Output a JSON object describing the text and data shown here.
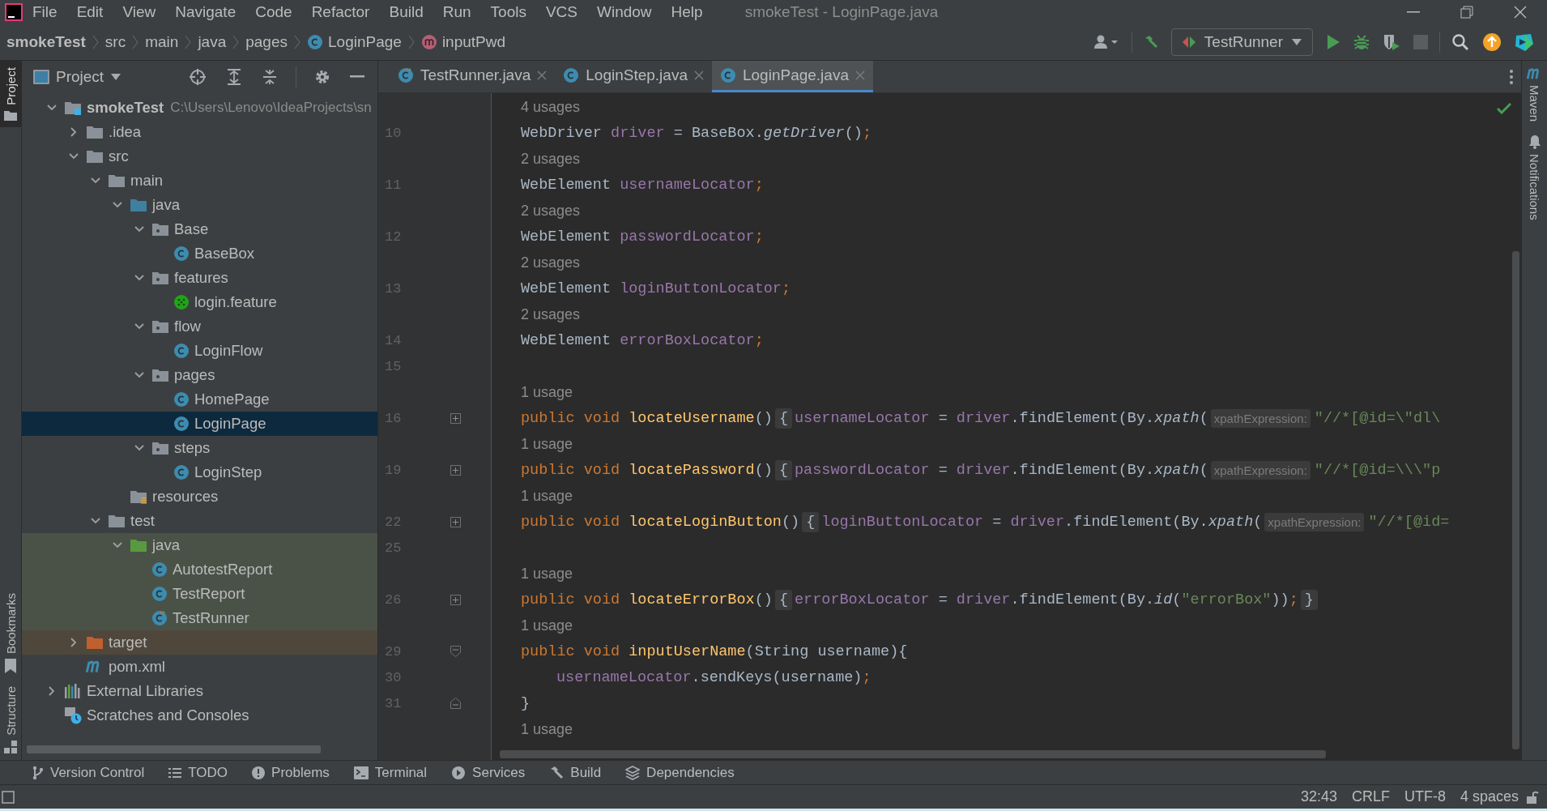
{
  "menu": [
    "File",
    "Edit",
    "View",
    "Navigate",
    "Code",
    "Refactor",
    "Build",
    "Run",
    "Tools",
    "VCS",
    "Window",
    "Help"
  ],
  "window": {
    "title": "smokeTest - LoginPage.java"
  },
  "breadcrumbs": [
    {
      "label": "smokeTest",
      "kind": "project"
    },
    {
      "label": "src",
      "kind": "folder"
    },
    {
      "label": "main",
      "kind": "folder"
    },
    {
      "label": "java",
      "kind": "folder"
    },
    {
      "label": "pages",
      "kind": "folder"
    },
    {
      "label": "LoginPage",
      "kind": "class"
    },
    {
      "label": "inputPwd",
      "kind": "method"
    }
  ],
  "run_config": {
    "label": "TestRunner"
  },
  "left_strip": {
    "top": [
      {
        "label": "Project",
        "kind": "folder",
        "selected": true
      }
    ],
    "bottom": [
      {
        "label": "Bookmarks",
        "kind": "bookmark",
        "selected": false
      },
      {
        "label": "Structure",
        "kind": "structure",
        "selected": false
      }
    ]
  },
  "project": {
    "title": "Project",
    "tree": [
      {
        "label": "smokeTest",
        "path": "C:\\Users\\Lenovo\\IdeaProjects\\sn",
        "kind": "module",
        "expanded": true,
        "selected": false,
        "children": [
          {
            "label": ".idea",
            "kind": "folder",
            "expanded": false,
            "selected": false
          },
          {
            "label": "src",
            "kind": "folder",
            "expanded": true,
            "selected": false,
            "children": [
              {
                "label": "main",
                "kind": "folder",
                "expanded": true,
                "selected": false,
                "children": [
                  {
                    "label": "java",
                    "kind": "source-root",
                    "expanded": true,
                    "selected": false,
                    "children": [
                      {
                        "label": "Base",
                        "kind": "package",
                        "expanded": true,
                        "selected": false,
                        "children": [
                          {
                            "label": "BaseBox",
                            "kind": "class",
                            "selected": false
                          }
                        ]
                      },
                      {
                        "label": "features",
                        "kind": "package",
                        "expanded": true,
                        "selected": false,
                        "children": [
                          {
                            "label": "login.feature",
                            "kind": "cucumber",
                            "selected": false
                          }
                        ]
                      },
                      {
                        "label": "flow",
                        "kind": "package",
                        "expanded": true,
                        "selected": false,
                        "children": [
                          {
                            "label": "LoginFlow",
                            "kind": "class",
                            "selected": false
                          }
                        ]
                      },
                      {
                        "label": "pages",
                        "kind": "package",
                        "expanded": true,
                        "selected": false,
                        "children": [
                          {
                            "label": "HomePage",
                            "kind": "class",
                            "selected": false
                          },
                          {
                            "label": "LoginPage",
                            "kind": "class",
                            "selected": true
                          }
                        ]
                      },
                      {
                        "label": "steps",
                        "kind": "package",
                        "expanded": true,
                        "selected": false,
                        "children": [
                          {
                            "label": "LoginStep",
                            "kind": "class",
                            "selected": false
                          }
                        ]
                      }
                    ]
                  },
                  {
                    "label": "resources",
                    "kind": "resources",
                    "selected": false
                  }
                ]
              },
              {
                "label": "test",
                "kind": "folder",
                "expanded": true,
                "selected": false,
                "children": [
                  {
                    "label": "java",
                    "kind": "test-root",
                    "expanded": true,
                    "selected": false,
                    "children": [
                      {
                        "label": "AutotestReport",
                        "kind": "class",
                        "selected": false
                      },
                      {
                        "label": "TestReport",
                        "kind": "class",
                        "selected": false
                      },
                      {
                        "label": "TestRunner",
                        "kind": "runner",
                        "selected": false
                      }
                    ]
                  }
                ]
              }
            ]
          },
          {
            "label": "target",
            "kind": "excluded",
            "expanded": false,
            "selected": false
          },
          {
            "label": "pom.xml",
            "kind": "maven",
            "selected": false
          }
        ]
      },
      {
        "label": "External Libraries",
        "kind": "libraries",
        "expanded": false,
        "selected": false
      },
      {
        "label": "Scratches and Consoles",
        "kind": "scratches",
        "selected": false
      }
    ]
  },
  "tabs": [
    {
      "label": "TestRunner.java",
      "kind": "runner",
      "selected": false
    },
    {
      "label": "LoginStep.java",
      "kind": "class",
      "selected": false
    },
    {
      "label": "LoginPage.java",
      "kind": "class",
      "selected": true
    }
  ],
  "editor": {
    "lines": [
      {
        "kind": "usage",
        "text": "4 usages"
      },
      {
        "kind": "code",
        "number": "10",
        "tokens": [
          {
            "text": "WebDriver ",
            "kind": "plain"
          },
          {
            "text": "driver",
            "kind": "field"
          },
          {
            "text": " = BaseBox.",
            "kind": "plain"
          },
          {
            "text": "getDriver",
            "kind": "italic"
          },
          {
            "text": "()",
            "kind": "plain"
          },
          {
            "text": ";",
            "kind": "punct"
          }
        ]
      },
      {
        "kind": "usage",
        "text": "2 usages"
      },
      {
        "kind": "code",
        "number": "11",
        "tokens": [
          {
            "text": "WebElement ",
            "kind": "plain"
          },
          {
            "text": "usernameLocator",
            "kind": "field"
          },
          {
            "text": ";",
            "kind": "punct"
          }
        ]
      },
      {
        "kind": "usage",
        "text": "2 usages"
      },
      {
        "kind": "code",
        "number": "12",
        "tokens": [
          {
            "text": "WebElement ",
            "kind": "plain"
          },
          {
            "text": "passwordLocator",
            "kind": "field"
          },
          {
            "text": ";",
            "kind": "punct"
          }
        ]
      },
      {
        "kind": "usage",
        "text": "2 usages"
      },
      {
        "kind": "code",
        "number": "13",
        "tokens": [
          {
            "text": "WebElement ",
            "kind": "plain"
          },
          {
            "text": "loginButtonLocator",
            "kind": "field"
          },
          {
            "text": ";",
            "kind": "punct"
          }
        ]
      },
      {
        "kind": "usage",
        "text": "2 usages"
      },
      {
        "kind": "code",
        "number": "14",
        "tokens": [
          {
            "text": "WebElement ",
            "kind": "plain"
          },
          {
            "text": "errorBoxLocator",
            "kind": "field"
          },
          {
            "text": ";",
            "kind": "punct"
          }
        ]
      },
      {
        "kind": "blank",
        "number": "15"
      },
      {
        "kind": "usage",
        "text": "1 usage"
      },
      {
        "kind": "folded",
        "number": "16",
        "tokens": [
          {
            "text": "public void ",
            "kind": "keyword"
          },
          {
            "text": "locateUsername",
            "kind": "method"
          },
          {
            "text": "()",
            "kind": "plain"
          },
          {
            "text": "{",
            "kind": "fold"
          },
          {
            "text": "usernameLocator",
            "kind": "field"
          },
          {
            "text": " = ",
            "kind": "plain"
          },
          {
            "text": "driver",
            "kind": "field"
          },
          {
            "text": ".findElement(By.",
            "kind": "plain"
          },
          {
            "text": "xpath",
            "kind": "italic"
          },
          {
            "text": "(",
            "kind": "plain"
          },
          {
            "text": "xpathExpression:",
            "kind": "hint"
          },
          {
            "text": "\"//*[@id=\\\"dl\\",
            "kind": "string"
          }
        ]
      },
      {
        "kind": "usage",
        "text": "1 usage"
      },
      {
        "kind": "folded",
        "number": "19",
        "tokens": [
          {
            "text": "public void ",
            "kind": "keyword"
          },
          {
            "text": "locatePassword",
            "kind": "method"
          },
          {
            "text": "()",
            "kind": "plain"
          },
          {
            "text": "{",
            "kind": "fold"
          },
          {
            "text": "passwordLocator",
            "kind": "field"
          },
          {
            "text": " = ",
            "kind": "plain"
          },
          {
            "text": "driver",
            "kind": "field"
          },
          {
            "text": ".findElement(By.",
            "kind": "plain"
          },
          {
            "text": "xpath",
            "kind": "italic"
          },
          {
            "text": "(",
            "kind": "plain"
          },
          {
            "text": "xpathExpression:",
            "kind": "hint"
          },
          {
            "text": "\"//*[@id=\\\\\\\"p",
            "kind": "string"
          }
        ]
      },
      {
        "kind": "usage",
        "text": "1 usage"
      },
      {
        "kind": "folded",
        "number": "22",
        "tokens": [
          {
            "text": "public void ",
            "kind": "keyword"
          },
          {
            "text": "locateLoginButton",
            "kind": "method"
          },
          {
            "text": "()",
            "kind": "plain"
          },
          {
            "text": "{",
            "kind": "fold"
          },
          {
            "text": "loginButtonLocator",
            "kind": "field"
          },
          {
            "text": " = ",
            "kind": "plain"
          },
          {
            "text": "driver",
            "kind": "field"
          },
          {
            "text": ".findElement(By.",
            "kind": "plain"
          },
          {
            "text": "xpath",
            "kind": "italic"
          },
          {
            "text": "(",
            "kind": "plain"
          },
          {
            "text": "xpathExpression:",
            "kind": "hint"
          },
          {
            "text": "\"//*[@id=",
            "kind": "string"
          }
        ]
      },
      {
        "kind": "blank",
        "number": "25"
      },
      {
        "kind": "usage",
        "text": "1 usage"
      },
      {
        "kind": "folded",
        "number": "26",
        "tokens": [
          {
            "text": "public void ",
            "kind": "keyword"
          },
          {
            "text": "locateErrorBox",
            "kind": "method"
          },
          {
            "text": "()",
            "kind": "plain"
          },
          {
            "text": "{",
            "kind": "fold"
          },
          {
            "text": "errorBoxLocator",
            "kind": "field"
          },
          {
            "text": " = ",
            "kind": "plain"
          },
          {
            "text": "driver",
            "kind": "field"
          },
          {
            "text": ".findElement(By.",
            "kind": "plain"
          },
          {
            "text": "id",
            "kind": "italic"
          },
          {
            "text": "(",
            "kind": "plain"
          },
          {
            "text": "\"errorBox\"",
            "kind": "string"
          },
          {
            "text": "))",
            "kind": "plain"
          },
          {
            "text": ";",
            "kind": "punct"
          },
          {
            "text": "}",
            "kind": "fold"
          }
        ]
      },
      {
        "kind": "usage",
        "text": "1 usage"
      },
      {
        "kind": "fold-start",
        "number": "29",
        "tokens": [
          {
            "text": "public void ",
            "kind": "keyword"
          },
          {
            "text": "inputUserName",
            "kind": "method"
          },
          {
            "text": "(String username){",
            "kind": "plain"
          }
        ]
      },
      {
        "kind": "indented",
        "number": "30",
        "tokens": [
          {
            "text": "usernameLocator",
            "kind": "field"
          },
          {
            "text": ".sendKeys(username)",
            "kind": "plain"
          },
          {
            "text": ";",
            "kind": "punct"
          }
        ]
      },
      {
        "kind": "fold-end",
        "number": "31",
        "tokens": [
          {
            "text": "}",
            "kind": "plain"
          }
        ]
      },
      {
        "kind": "usage",
        "text": "1 usage"
      }
    ]
  },
  "right_strip": [
    {
      "label": "Maven",
      "kind": "maven"
    },
    {
      "label": "Notifications",
      "kind": "bell"
    }
  ],
  "tool_windows": [
    {
      "label": "Version Control",
      "kind": "branch"
    },
    {
      "label": "TODO",
      "kind": "list"
    },
    {
      "label": "Problems",
      "kind": "alert"
    },
    {
      "label": "Terminal",
      "kind": "terminal"
    },
    {
      "label": "Services",
      "kind": "services"
    },
    {
      "label": "Build",
      "kind": "hammer"
    },
    {
      "label": "Dependencies",
      "kind": "layers"
    }
  ],
  "status": [
    "32:43",
    "CRLF",
    "UTF-8",
    "4 spaces"
  ]
}
